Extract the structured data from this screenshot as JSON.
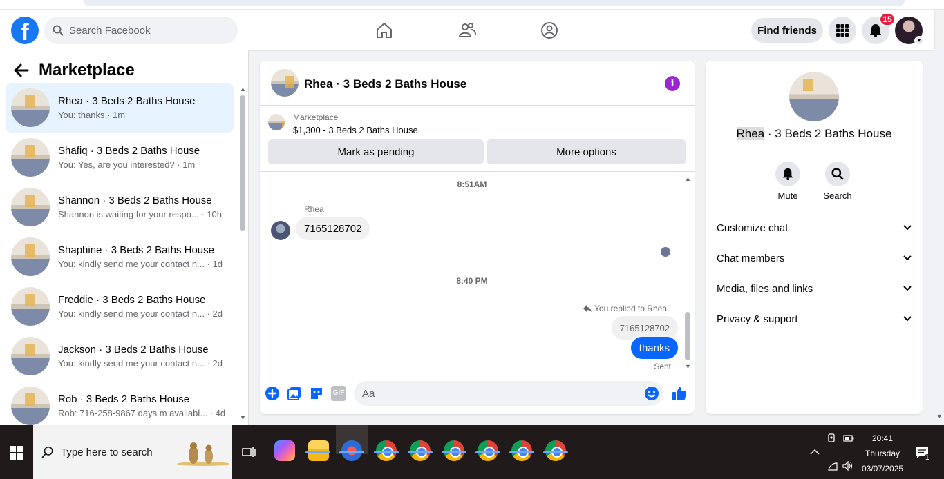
{
  "navbar": {
    "logo": "f",
    "search_placeholder": "Search Facebook",
    "find_friends": "Find friends",
    "notifications_count": "15"
  },
  "left_panel": {
    "title": "Marketplace",
    "conversations": [
      {
        "title": "Rhea · 3 Beds 2 Baths House",
        "preview": "You: thanks · 1m"
      },
      {
        "title": "Shafiq · 3 Beds 2 Baths House",
        "preview": "You: Yes, are you interested? · 1m"
      },
      {
        "title": "Shannon · 3 Beds 2 Baths House",
        "preview": "Shannon is waiting for your respo... · 10h"
      },
      {
        "title": "Shaphine · 3 Beds 2 Baths House",
        "preview": "You: kindly send me your contact n... · 1d"
      },
      {
        "title": "Freddie · 3 Beds 2 Baths House",
        "preview": "You: kindly send me your contact n... · 2d"
      },
      {
        "title": "Jackson · 3 Beds 2 Baths House",
        "preview": "You: kindly send me your contact n... · 2d"
      },
      {
        "title": "Rob · 3 Beds 2 Baths House",
        "preview": "Rob: 716-258-9867 days m availabl... · 4d"
      }
    ]
  },
  "chat": {
    "title": "Rhea · 3 Beds 2 Baths House",
    "marketplace_label": "Marketplace",
    "listing": "$1,300 - 3 Beds 2 Baths House",
    "mark_pending": "Mark as pending",
    "more_options": "More options",
    "time1": "8:51AM",
    "sender": "Rhea",
    "incoming": "7165128702",
    "time2": "8:40 PM",
    "replied_to": "You replied to Rhea",
    "quoted": "7165128702",
    "outgoing": "thanks",
    "status": "Sent",
    "composer_placeholder": "Aa",
    "gif_label": "GIF"
  },
  "right_panel": {
    "name_highlight": "Rhea",
    "name_rest": " · 3 Beds 2 Baths House",
    "mute": "Mute",
    "search": "Search",
    "sections": [
      "Customize chat",
      "Chat members",
      "Media, files and links",
      "Privacy & support"
    ]
  },
  "taskbar": {
    "search_placeholder": "Type here to search",
    "time": "20:41",
    "day": "Thursday",
    "date": "03/07/2025",
    "notif_count": "1"
  },
  "colors": {
    "fb_blue": "#1877f2",
    "message_blue": "#0866ff",
    "badge_red": "#e41e3f",
    "info_purple": "#9b25d4"
  }
}
